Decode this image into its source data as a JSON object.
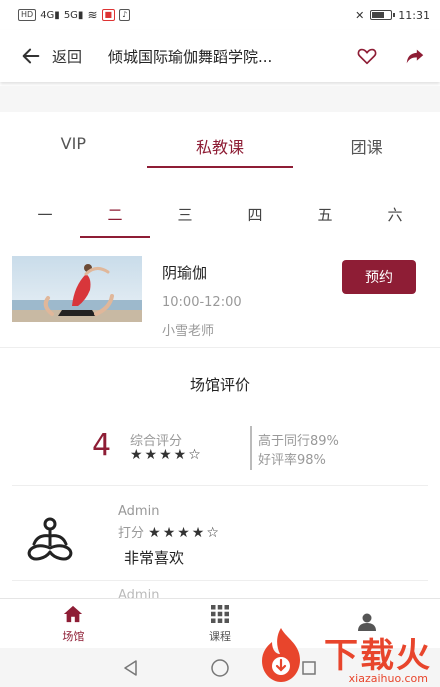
{
  "status_bar": {
    "left_chips": [
      "HD",
      "4G",
      "5G"
    ],
    "time": "11:31"
  },
  "header": {
    "back_label": "返回",
    "title": "倾城国际瑜伽舞蹈学院...",
    "icons": [
      "heart-icon",
      "share-icon"
    ]
  },
  "tabs": [
    {
      "label": "VIP",
      "active": false
    },
    {
      "label": "私教课",
      "active": true
    },
    {
      "label": "团课",
      "active": false
    }
  ],
  "days": [
    {
      "label": "一",
      "active": false
    },
    {
      "label": "二",
      "active": true
    },
    {
      "label": "三",
      "active": false
    },
    {
      "label": "四",
      "active": false
    },
    {
      "label": "五",
      "active": false
    },
    {
      "label": "六",
      "active": false
    }
  ],
  "course": {
    "name": "阴瑜伽",
    "time": "10:00-12:00",
    "teacher": "小雪老师",
    "book_label": "预约"
  },
  "reviews": {
    "title": "场馆评价",
    "score": "4",
    "score_label": "综合评分",
    "score_stars": "★★★★☆",
    "higher_than_peers": "高于同行89%",
    "good_rate": "好评率98%",
    "items": [
      {
        "user": "Admin",
        "rating_label": "打分",
        "stars": "★★★★☆",
        "text": "非常喜欢"
      }
    ],
    "next_user": "Admin"
  },
  "tabbar": [
    {
      "label": "场馆",
      "icon": "home-icon",
      "active": true
    },
    {
      "label": "课程",
      "icon": "grid-icon",
      "active": false
    },
    {
      "label": "",
      "icon": "user-icon",
      "active": false
    }
  ],
  "watermark": {
    "text": "下载火",
    "url": "xiazaihuo.com"
  },
  "colors": {
    "accent": "#8e1d35",
    "watermark": "#e8452c"
  }
}
